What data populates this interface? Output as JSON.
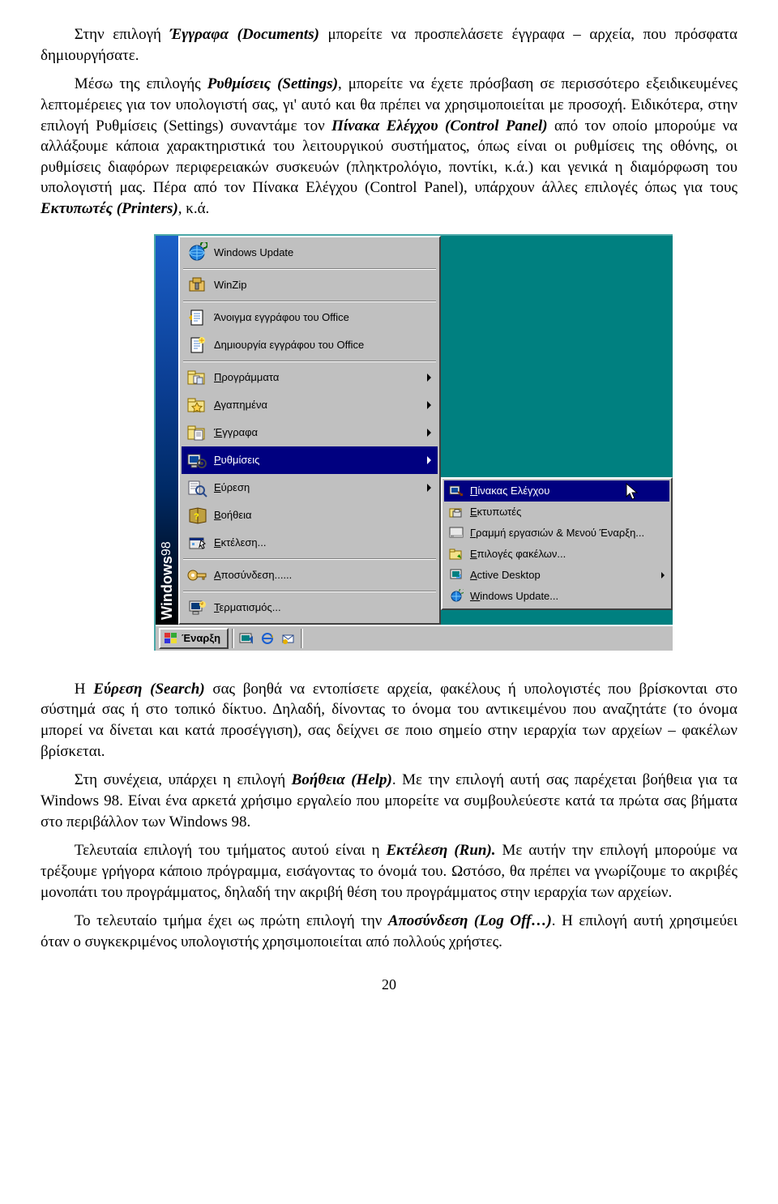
{
  "paragraphs": {
    "p1_a": "Στην επιλογή ",
    "p1_b": "Έγγραφα (Documents)",
    "p1_c": " μπορείτε να προσπελάσετε έγγραφα – αρχεία, που πρόσφατα δημιουργήσατε.",
    "p2_a": "Μέσω της επιλογής ",
    "p2_b": "Ρυθμίσεις (Settings)",
    "p2_c": ", μπορείτε να έχετε πρόσβαση σε περισσότερο εξειδικευμένες λεπτομέρειες για τον υπολογιστή σας, γι' αυτό και θα πρέπει να χρησιμοποιείται με προσοχή. Ειδικότερα, στην επιλογή Ρυθμίσεις (Settings) συναντάμε τον ",
    "p2_d": "Πίνακα Ελέγχου (Control Panel)",
    "p2_e": " από τον οποίο μπορούμε να αλλάξουμε κάποια χαρακτηριστικά του λειτουργικού συστήματος, όπως είναι οι ρυθμίσεις της οθόνης, οι ρυθμίσεις διαφόρων περιφερειακών συσκευών (πληκτρολόγιο, ποντίκι, κ.ά.) και γενικά η διαμόρφωση του υπολογιστή μας. Πέρα από τον Πίνακα Ελέγχου (Control Panel), υπάρχουν άλλες επιλογές όπως για τους ",
    "p2_f": "Εκτυπωτές (Printers)",
    "p2_g": ", κ.ά.",
    "p3_a": "Η ",
    "p3_b": "Εύρεση (Search)",
    "p3_c": " σας βοηθά να εντοπίσετε αρχεία, φακέλους ή υπολογιστές που βρίσκονται στο σύστημά σας ή στο τοπικό δίκτυο. Δηλαδή, δίνοντας το όνομα του αντικειμένου που αναζητάτε (το όνομα μπορεί να δίνεται και κατά προσέγγιση), σας δείχνει σε ποιο σημείο στην ιεραρχία των αρχείων – φακέλων βρίσκεται.",
    "p4_a": "Στη συνέχεια, υπάρχει η επιλογή ",
    "p4_b": "Βοήθεια (Help)",
    "p4_c": ". Με την επιλογή αυτή σας παρέχεται βοήθεια για τα Windows 98. Είναι ένα αρκετά χρήσιμο εργαλείο που μπορείτε να συμβουλεύεστε κατά τα πρώτα σας βήματα στο περιβάλλον των Windows 98.",
    "p5_a": "Τελευταία επιλογή του τμήματος αυτού είναι η ",
    "p5_b": "Εκτέλεση (Run).",
    "p5_c": " Με αυτήν την επιλογή μπορούμε να τρέξουμε γρήγορα κάποιο πρόγραμμα, εισάγοντας το όνομά του. Ωστόσο, θα πρέπει να γνωρίζουμε το ακριβές μονοπάτι του προγράμματος, δηλαδή την ακριβή θέση του προγράμματος στην ιεραρχία των αρχείων.",
    "p6_a": "Το τελευταίο τμήμα έχει ως πρώτη επιλογή την ",
    "p6_b": "Αποσύνδεση (Log Off…)",
    "p6_c": ". Η επιλογή αυτή χρησιμεύει όταν ο συγκεκριμένος υπολογιστής χρησιμοποιείται από πολλούς χρήστες."
  },
  "screenshot": {
    "banner_main": "Windows",
    "banner_ver": "98",
    "menu": {
      "windows_update": "Windows Update",
      "winzip": "WinZip",
      "open_office_doc": "Άνοιγμα εγγράφου του Office",
      "new_office_doc": "Δημιουργία εγγράφου του Office",
      "programs_u": "Π",
      "programs_rest": "ρογράμματα",
      "favorites_u": "Α",
      "favorites_rest": "γαπημένα",
      "documents_u": "Έ",
      "documents_rest": "γγραφα",
      "settings_u": "Ρ",
      "settings_rest": "υθμίσεις",
      "search_u": "Ε",
      "search_rest": "ύρεση",
      "help_u": "Β",
      "help_rest": "οήθεια",
      "run_u": "Ε",
      "run_rest": "κτέλεση...",
      "logoff_u": "Α",
      "logoff_rest": "ποσύνδεση......",
      "shutdown_u": "Τ",
      "shutdown_rest": "ερματισμός..."
    },
    "submenu": {
      "control_panel_u": "Π",
      "control_panel_rest": "ίνακας Ελέγχου",
      "printers_u": "Ε",
      "printers_rest": "κτυπωτές",
      "taskbar_u": "Γ",
      "taskbar_rest": "ραμμή εργασιών & Μενού Έναρξη...",
      "folder_opts_u": "Ε",
      "folder_opts_rest": "πιλογές φακέλων...",
      "active_desktop_u": "A",
      "active_desktop_rest": "ctive Desktop",
      "windows_update_u": "W",
      "windows_update_rest": "indows Update..."
    },
    "taskbar": {
      "start": "Έναρξη"
    }
  },
  "page_number": "20"
}
